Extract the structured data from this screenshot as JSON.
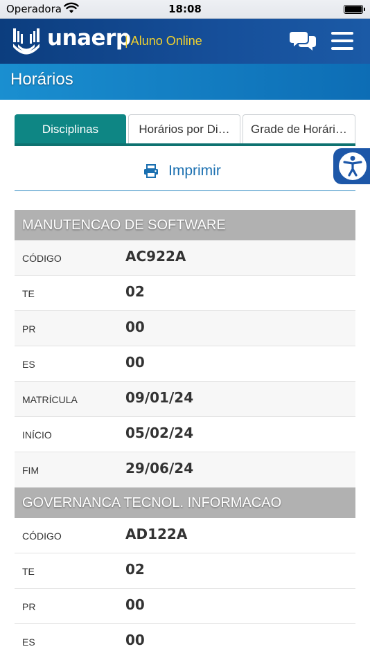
{
  "status_bar": {
    "carrier": "Operadora",
    "time": "18:08"
  },
  "header": {
    "logo_text": "unaerp",
    "logo_subtitle": "| Aluno Online",
    "chat_icon": "chat-bubbles-icon",
    "menu_icon": "hamburger-menu-icon"
  },
  "page": {
    "title": "Horários"
  },
  "tabs": [
    {
      "label": "Disciplinas",
      "active": true
    },
    {
      "label": "Horários por Di…",
      "active": false
    },
    {
      "label": "Grade de Horári…",
      "active": false
    }
  ],
  "print": {
    "label": "Imprimir",
    "icon": "printer-icon"
  },
  "accessibility": {
    "icon": "accessibility-icon"
  },
  "disciplines": [
    {
      "name": "MANUTENCAO DE SOFTWARE",
      "rows": [
        {
          "label": "CÓDIGO",
          "value": "AC922A"
        },
        {
          "label": "TE",
          "value": "02"
        },
        {
          "label": "PR",
          "value": "00"
        },
        {
          "label": "ES",
          "value": "00"
        },
        {
          "label": "MATRÍCULA",
          "value": "09/01/24"
        },
        {
          "label": "INÍCIO",
          "value": "05/02/24"
        },
        {
          "label": "FIM",
          "value": "29/06/24"
        }
      ]
    },
    {
      "name": "GOVERNANCA TECNOL. INFORMACAO",
      "rows": [
        {
          "label": "CÓDIGO",
          "value": "AD122A"
        },
        {
          "label": "TE",
          "value": "02"
        },
        {
          "label": "PR",
          "value": "00"
        },
        {
          "label": "ES",
          "value": "00"
        }
      ]
    }
  ],
  "colors": {
    "header_bg": "#0c3d7e",
    "title_bg": "#1a8fd0",
    "tab_active": "#0e8684",
    "logo_subtitle": "#f2d22e",
    "section_head": "#b1b1b1",
    "link": "#1a6fb0"
  }
}
